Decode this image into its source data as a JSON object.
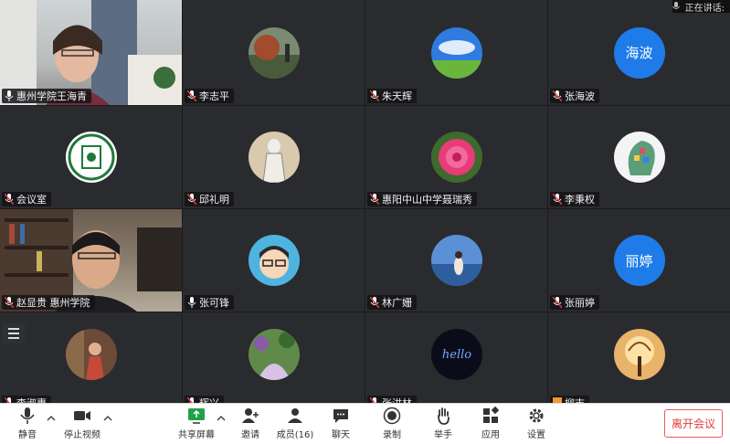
{
  "speaking_indicator": {
    "label": "正在讲话:"
  },
  "participants": [
    {
      "name": "惠州学院王海青",
      "type": "video",
      "mic": "on"
    },
    {
      "name": "李志平",
      "type": "image",
      "image": "landscape-photo",
      "mic": "muted"
    },
    {
      "name": "朱天辉",
      "type": "image",
      "image": "blue-sky-field",
      "mic": "muted"
    },
    {
      "name": "张海波",
      "type": "text",
      "avatar_text": "海波",
      "mic": "muted"
    },
    {
      "name": "会议室",
      "type": "image",
      "image": "huizhou-university-logo",
      "mic": "muted"
    },
    {
      "name": "邱礼明",
      "type": "image",
      "image": "ink-figure-painting",
      "mic": "muted"
    },
    {
      "name": "惠阳中山中学聂瑞秀",
      "type": "image",
      "image": "pink-peony",
      "mic": "muted"
    },
    {
      "name": "李秉权",
      "type": "image",
      "image": "colorful-head-graphic",
      "mic": "muted"
    },
    {
      "name": "赵显贵 惠州学院",
      "type": "video",
      "mic": "muted"
    },
    {
      "name": "张可锋",
      "type": "image",
      "image": "cartoon-boy-glasses",
      "mic": "on"
    },
    {
      "name": "林广姗",
      "type": "image",
      "image": "person-by-sea",
      "mic": "muted"
    },
    {
      "name": "张丽婷",
      "type": "text",
      "avatar_text": "丽婷",
      "mic": "muted"
    },
    {
      "name": "李淑惠",
      "type": "image",
      "image": "person-photo",
      "mic": "muted"
    },
    {
      "name": "辉兴",
      "type": "image",
      "image": "garden-path",
      "mic": "muted"
    },
    {
      "name": "张洪林",
      "type": "image",
      "image": "hello-neon",
      "mic": "muted"
    },
    {
      "name": "柳志",
      "type": "image",
      "image": "glowing-tree",
      "mic": "muted"
    }
  ],
  "toolbar": {
    "mute": "静音",
    "stop_video": "停止视频",
    "share_screen": "共享屏幕",
    "invite": "邀请",
    "members": "成员(16)",
    "chat": "聊天",
    "record": "录制",
    "raise_hand": "举手",
    "apps": "应用",
    "settings": "设置",
    "leave_meeting": "离开会议"
  },
  "colors": {
    "accent_blue": "#1e7be8",
    "leave_red": "#e23c3c",
    "tile_bg": "#2a2b2e",
    "share_green": "#21a24a"
  }
}
